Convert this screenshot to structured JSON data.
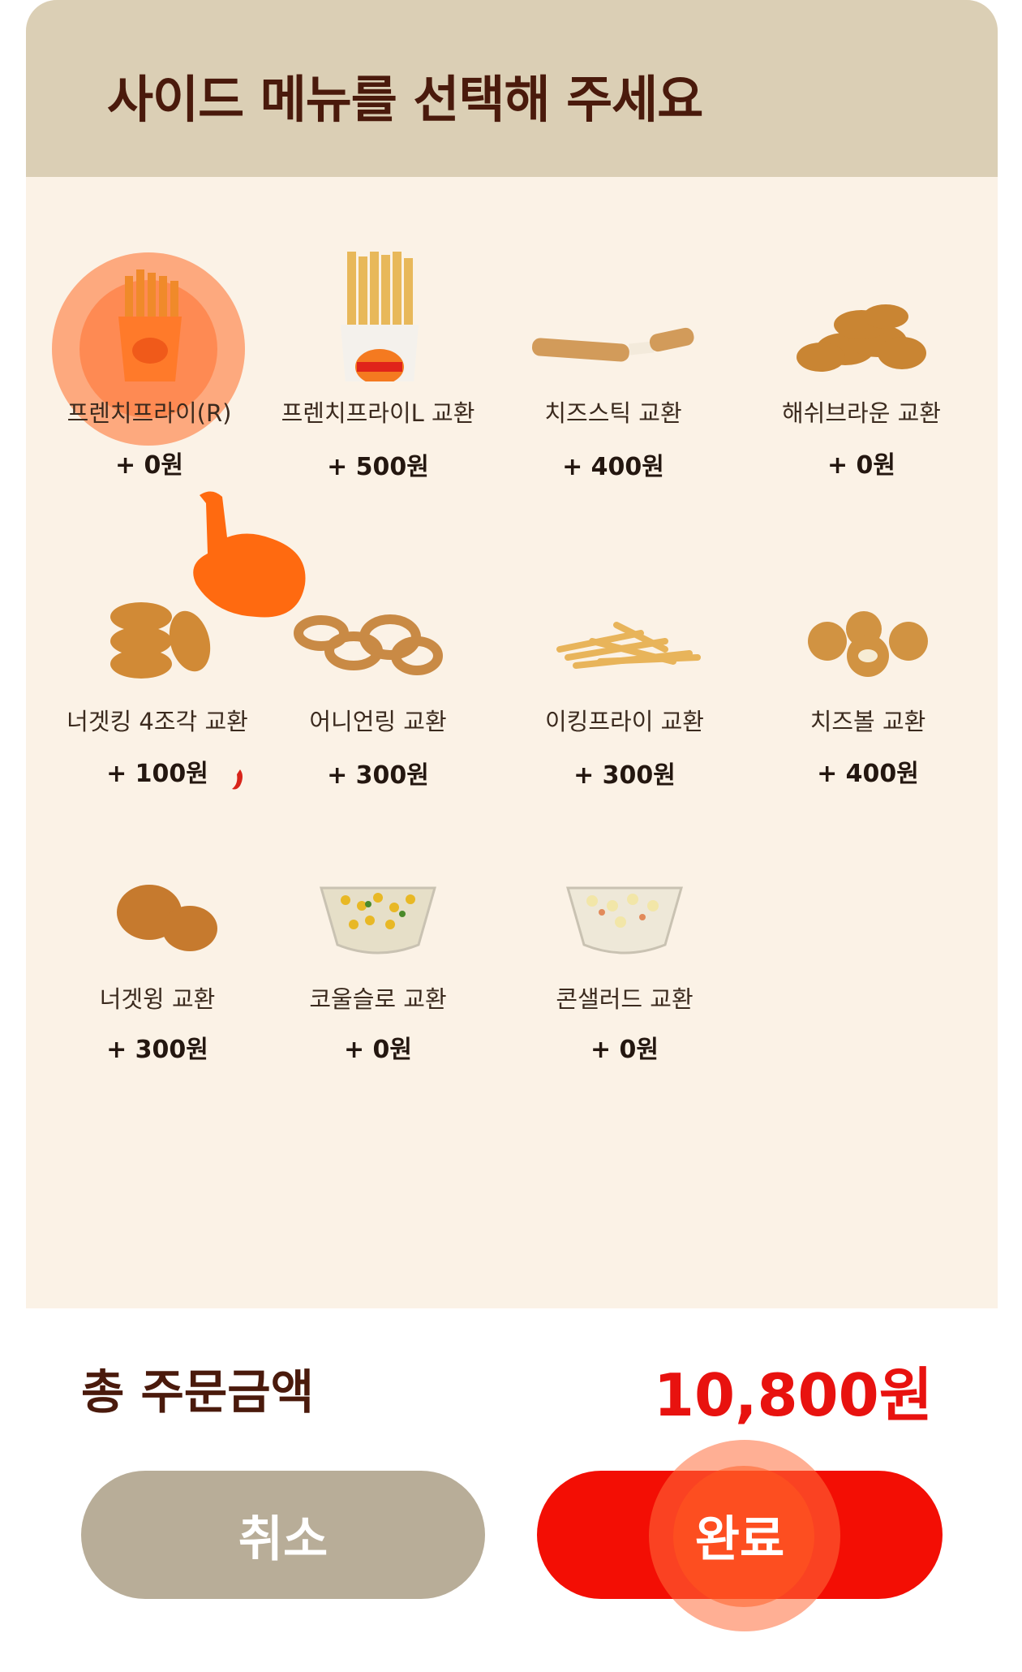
{
  "header": {
    "title": "사이드 메뉴를 선택해 주세요"
  },
  "items": [
    {
      "name": "프렌치프라이(R)",
      "price": "+ 0원",
      "icon": "fries-regular-icon",
      "selected": true
    },
    {
      "name": "프렌치프라이L 교환",
      "price": "+ 500원",
      "icon": "fries-large-icon"
    },
    {
      "name": "치즈스틱 교환",
      "price": "+ 400원",
      "icon": "cheese-stick-icon"
    },
    {
      "name": "해쉬브라운 교환",
      "price": "+ 0원",
      "icon": "hash-brown-icon"
    },
    {
      "name": "너겟킹 4조각 교환",
      "price": "+ 100원",
      "icon": "nugget-icon"
    },
    {
      "name": "어니언링 교환",
      "price": "+ 300원",
      "icon": "onion-ring-icon"
    },
    {
      "name": "이킹프라이 교환",
      "price": "+ 300원",
      "icon": "e-king-fries-icon"
    },
    {
      "name": "치즈볼 교환",
      "price": "+ 400원",
      "icon": "cheese-ball-icon"
    },
    {
      "name": "너겟윙 교환",
      "price": "+ 300원",
      "icon": "nugget-wing-icon"
    },
    {
      "name": "코울슬로 교환",
      "price": "+ 0원",
      "icon": "coleslaw-icon"
    },
    {
      "name": "콘샐러드 교환",
      "price": "+ 0원",
      "icon": "corn-salad-icon"
    }
  ],
  "footer": {
    "total_label": "총 주문금액",
    "total_value": "10,800원",
    "cancel_label": "취소",
    "done_label": "완료"
  },
  "colors": {
    "accent": "#f30e04",
    "header_bg": "#dbcfb5",
    "panel_bg": "#fbf2e6",
    "title": "#4a1a0c",
    "cancel": "#b8ad98"
  }
}
